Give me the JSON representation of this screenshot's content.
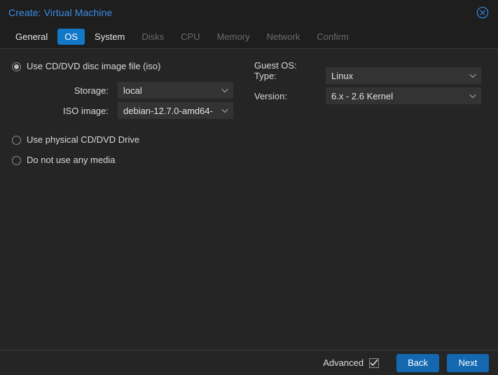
{
  "window": {
    "title": "Create: Virtual Machine",
    "title_color": "#3a8ee6",
    "close_icon": "close-circle-icon"
  },
  "tabs": [
    {
      "label": "General",
      "state": "enabled"
    },
    {
      "label": "OS",
      "state": "active"
    },
    {
      "label": "System",
      "state": "enabled"
    },
    {
      "label": "Disks",
      "state": "disabled"
    },
    {
      "label": "CPU",
      "state": "disabled"
    },
    {
      "label": "Memory",
      "state": "disabled"
    },
    {
      "label": "Network",
      "state": "disabled"
    },
    {
      "label": "Confirm",
      "state": "disabled"
    }
  ],
  "media": {
    "options": [
      {
        "label": "Use CD/DVD disc image file (iso)",
        "selected": true
      },
      {
        "label": "Use physical CD/DVD Drive",
        "selected": false
      },
      {
        "label": "Do not use any media",
        "selected": false
      }
    ],
    "storage": {
      "label": "Storage:",
      "value": "local",
      "chevron": "chevron-down-icon"
    },
    "iso_image": {
      "label": "ISO image:",
      "value": "debian-12.7.0-amd64-",
      "chevron": "chevron-down-icon"
    }
  },
  "guest_os": {
    "heading": "Guest OS:",
    "type": {
      "label": "Type:",
      "value": "Linux",
      "chevron": "chevron-down-icon"
    },
    "version": {
      "label": "Version:",
      "value": "6.x - 2.6 Kernel",
      "chevron": "chevron-down-icon"
    }
  },
  "footer": {
    "advanced_label": "Advanced",
    "advanced_checked": true,
    "back_label": "Back",
    "next_label": "Next",
    "button_color": "#1368b0"
  }
}
